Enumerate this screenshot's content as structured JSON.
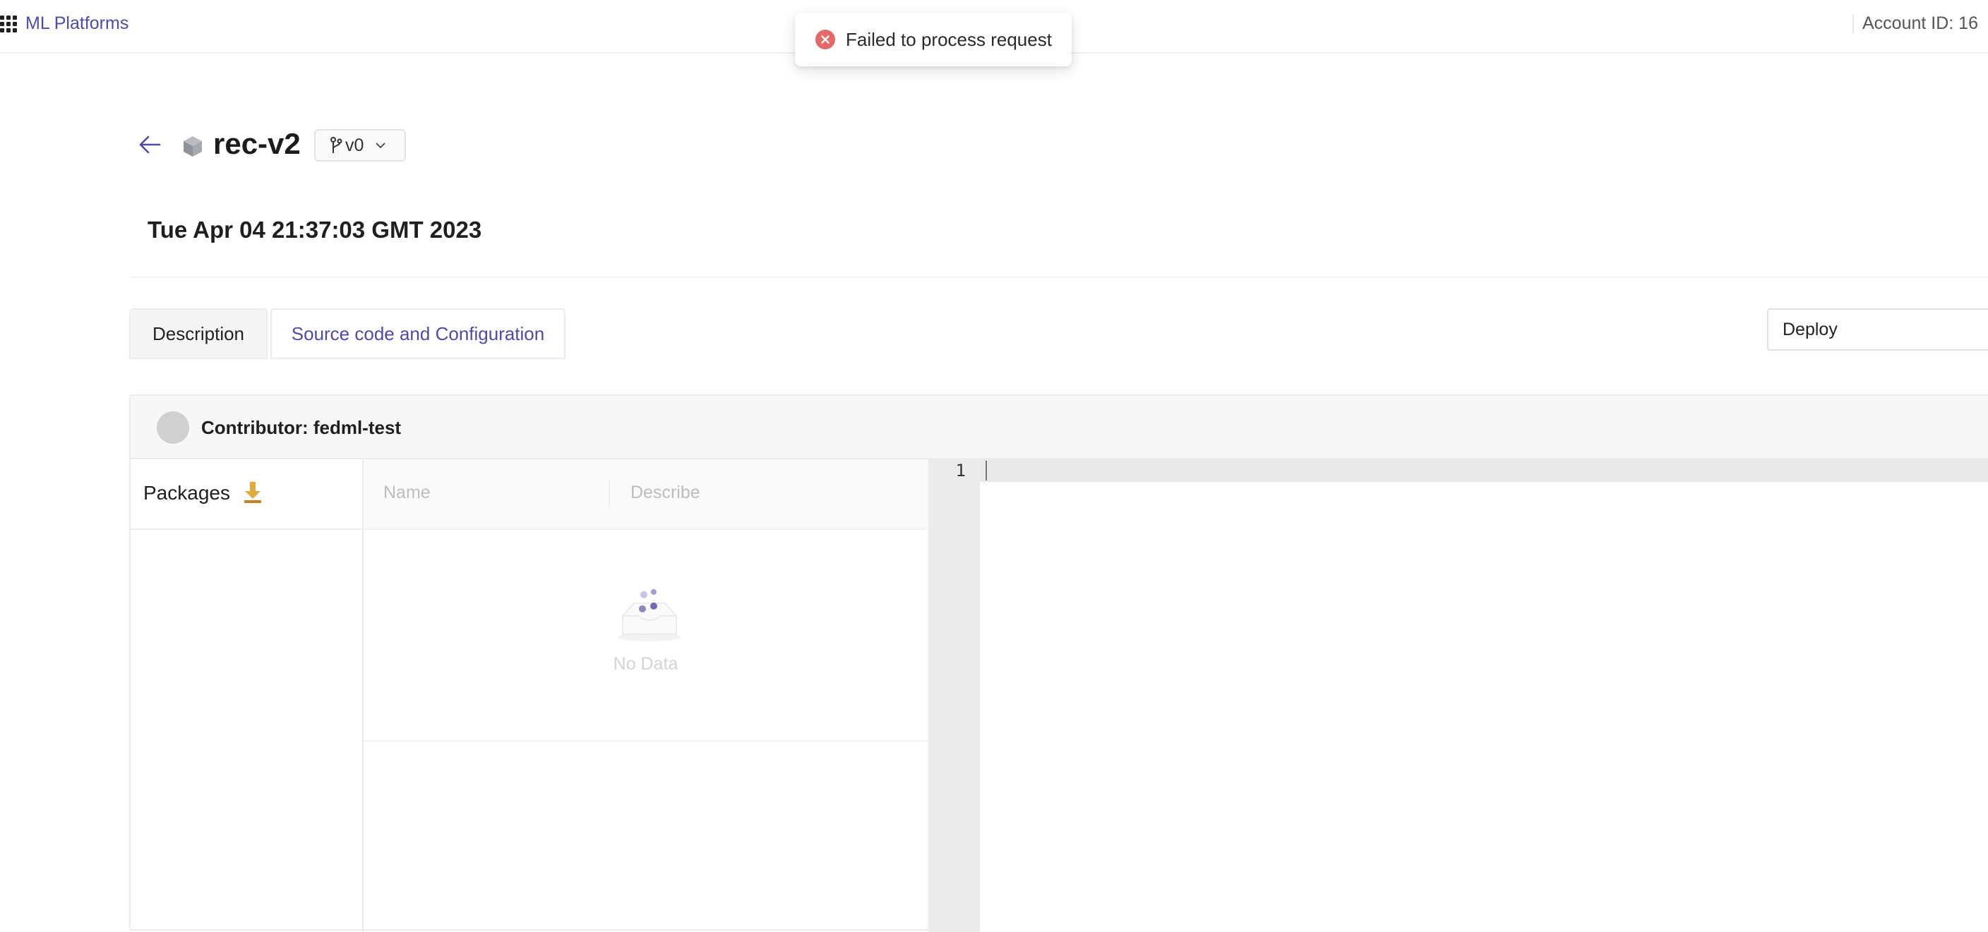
{
  "topbar": {
    "brand": "ML Platforms",
    "account": "Account ID: 16"
  },
  "toast": {
    "message": "Failed to process request",
    "icon": "error-circle-icon",
    "color": "#e46a6a"
  },
  "header": {
    "model_name": "rec-v2",
    "version": "v0",
    "date": "Tue Apr 04 21:37:03 GMT 2023"
  },
  "tabs": [
    {
      "label": "Description",
      "active": false
    },
    {
      "label": "Source code and Configuration",
      "active": true
    }
  ],
  "deploy": {
    "label": "Deploy"
  },
  "card": {
    "contributor": "Contributor: fedml-test",
    "packages_title": "Packages",
    "table": {
      "columns": [
        "Name",
        "Describe"
      ],
      "empty_text": "No Data"
    },
    "editor": {
      "line_numbers": [
        "1"
      ]
    }
  },
  "colors": {
    "accent": "#4f4aa6",
    "download_icon": "#e2a93b"
  }
}
